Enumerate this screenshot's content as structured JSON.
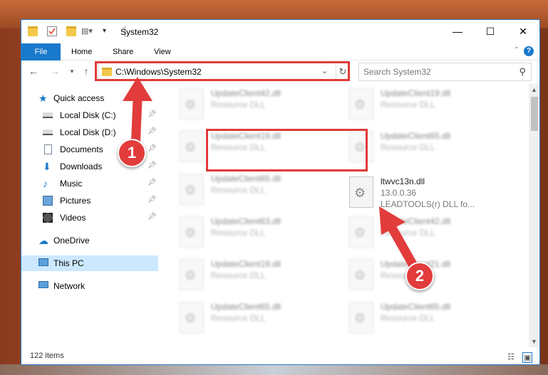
{
  "window": {
    "title": "System32",
    "controls": [
      "minimize-icon",
      "maximize-icon",
      "close-icon"
    ]
  },
  "ribbon": {
    "file_label": "File",
    "tabs": [
      "Home",
      "Share",
      "View"
    ],
    "help_label": "?"
  },
  "address": {
    "path": "C:\\Windows\\System32"
  },
  "search": {
    "placeholder": "Search System32"
  },
  "nav": {
    "items": [
      {
        "label": "Quick access",
        "icon": "star-icon",
        "pinned": false
      },
      {
        "label": "Local Disk (C:)",
        "icon": "drive-icon",
        "pinned": true
      },
      {
        "label": "Local Disk (D:)",
        "icon": "drive-icon",
        "pinned": true
      },
      {
        "label": "Documents",
        "icon": "documents-icon",
        "pinned": true
      },
      {
        "label": "Downloads",
        "icon": "download-icon",
        "pinned": true
      },
      {
        "label": "Music",
        "icon": "music-icon",
        "pinned": true
      },
      {
        "label": "Pictures",
        "icon": "pictures-icon",
        "pinned": true
      },
      {
        "label": "Videos",
        "icon": "videos-icon",
        "pinned": true
      },
      {
        "label": "OneDrive",
        "icon": "cloud-icon",
        "pinned": false
      },
      {
        "label": "This PC",
        "icon": "computer-icon",
        "pinned": false,
        "selected": true
      },
      {
        "label": "Network",
        "icon": "network-icon",
        "pinned": false
      }
    ]
  },
  "files": [
    {
      "name": "UpdateClient42.dll",
      "desc": "Resource DLL",
      "blurred": true
    },
    {
      "name": "UpdateClient19.dll",
      "desc": "Resource DLL",
      "blurred": true
    },
    {
      "name": "UpdateClient19.dll",
      "desc": "Resource DLL",
      "blurred": true
    },
    {
      "name": "UpdateClient65.dll",
      "desc": "Resource DLL",
      "blurred": true
    },
    {
      "name": "UpdateClient65.dll",
      "desc": "Resource DLL",
      "blurred": true
    },
    {
      "name": "ltwvc13n.dll",
      "desc": "13.0.0.36",
      "extra": "LEADTOOLS(r) DLL fo...",
      "blurred": false
    },
    {
      "name": "UpdateClient63.dll",
      "desc": "Resource DLL",
      "blurred": true
    },
    {
      "name": "UpdateClient42.dll",
      "desc": "Resource DLL",
      "blurred": true
    },
    {
      "name": "UpdateClient19.dll",
      "desc": "Resource DLL",
      "blurred": true
    },
    {
      "name": "UpdateClient21.dll",
      "desc": "Resource DLL",
      "blurred": true
    },
    {
      "name": "UpdateClient65.dll",
      "desc": "Resource DLL",
      "blurred": true
    },
    {
      "name": "UpdateClient65.dll",
      "desc": "Resource DLL",
      "blurred": true
    }
  ],
  "status": {
    "item_count": "122 items"
  },
  "callouts": [
    "1",
    "2"
  ],
  "colors": {
    "accent": "#1979ca",
    "highlight": "#e03a3a",
    "selected_bg": "#cce8ff"
  }
}
